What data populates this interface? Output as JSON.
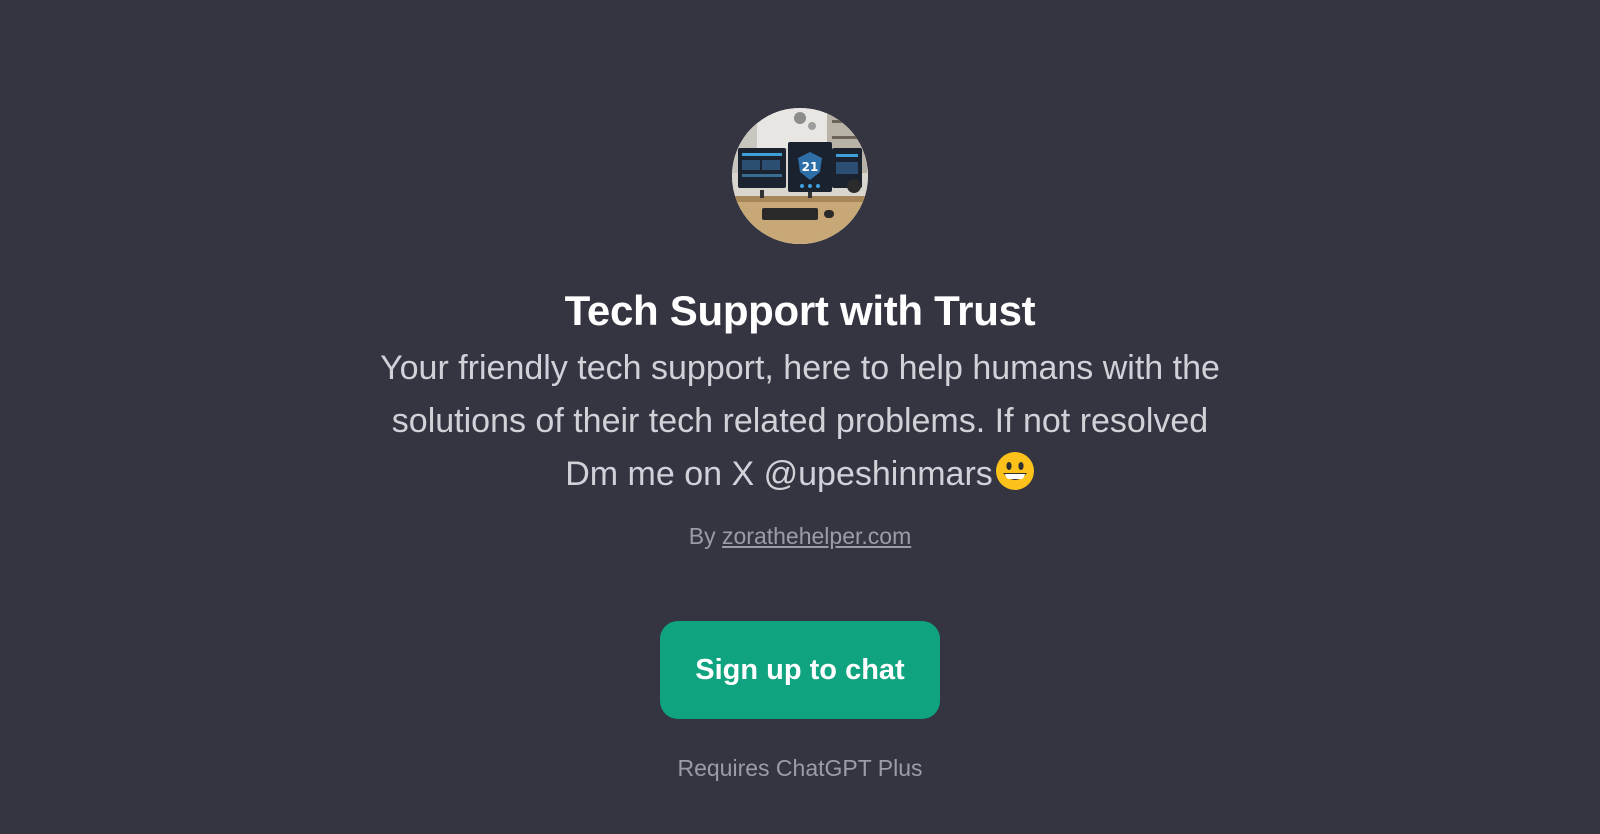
{
  "gpt": {
    "avatar_icon": "tech-support-workstation-avatar",
    "title": "Tech Support with Trust",
    "description": "Your friendly tech support, here to help humans with the solutions of their tech related problems. If not resolved Dm me on X @upeshinmars",
    "description_emoji": "grinning-face-emoji",
    "byline_prefix": "By",
    "author_link": "zorathehelper.com"
  },
  "cta": {
    "label": "Sign up to chat",
    "color": "#10a37f"
  },
  "footer": {
    "requires": "Requires ChatGPT Plus"
  },
  "colors": {
    "background": "#343541",
    "title": "#ffffff",
    "description": "#d1d1d8",
    "muted": "#9b9ca6"
  }
}
